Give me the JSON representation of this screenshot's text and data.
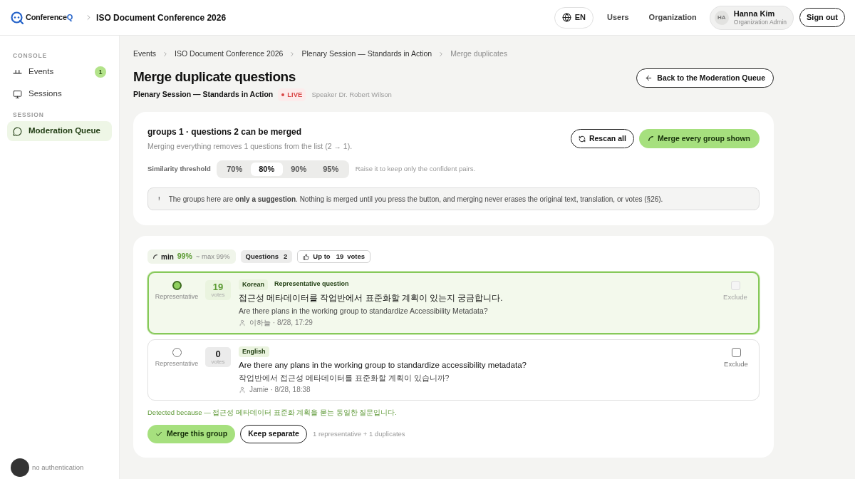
{
  "top_bar": {
    "logo": {
      "name": "Conference",
      "accent": "Q"
    },
    "event": "ISO Document Conference 2026",
    "language": "EN",
    "nav": [
      "Users",
      "Organization"
    ],
    "user": {
      "initials": "HA",
      "name": "Hanna Kim",
      "role": "Organization Admin"
    },
    "sign_out": "Sign out"
  },
  "sidebar": {
    "sections": [
      {
        "label": "CONSOLE",
        "items": [
          {
            "label": "Events",
            "badge": "1",
            "selected": false
          },
          {
            "label": "Sessions",
            "selected": false
          }
        ]
      },
      {
        "label": "SESSION",
        "items": [
          {
            "label": "Moderation Queue",
            "selected": true
          }
        ]
      }
    ],
    "footer": {
      "status": "no authentication"
    }
  },
  "breadcrumbs": [
    {
      "label": "Events",
      "current": false
    },
    {
      "label": "ISO Document Conference 2026",
      "current": false
    },
    {
      "label": "Plenary Session — Standards in Action",
      "current": false
    },
    {
      "label": "Merge duplicates",
      "current": true
    }
  ],
  "header": {
    "title": "Merge duplicate questions",
    "session": "Plenary Session — Standards in Action",
    "live": "LIVE",
    "speaker": "Speaker Dr. Robert Wilson",
    "back_button": "Back to the Moderation Queue"
  },
  "summary": {
    "title": "groups 1 · questions 2 can be merged",
    "subtitle": "Merging everything removes 1 questions from the list (2 → 1).",
    "buttons": [
      {
        "label": "Rescan all",
        "kind": "outline"
      },
      {
        "label": "Merge every group shown",
        "kind": "primary"
      }
    ],
    "threshold": {
      "label": "Similarity threshold",
      "options": [
        {
          "label": "70%",
          "selected": false
        },
        {
          "label": "80%",
          "selected": true
        },
        {
          "label": "90%",
          "selected": false
        },
        {
          "label": "95%",
          "selected": false
        }
      ],
      "hint": "Raise it to keep only the confident pairs."
    },
    "notice": {
      "mark": "!",
      "text": "The groups here are **only a suggestion**. Nothing is merged until you press the button, and merging never erases the original text, translation, or votes (§26)."
    }
  },
  "groups": [
    {
      "similarity": {
        "min_label": "min",
        "min": "99%",
        "max": "~ max 99%"
      },
      "questions_chip": {
        "label": "Questions",
        "count": "2"
      },
      "votes_chip": {
        "prefix": "Up to",
        "count": "19",
        "suffix": "votes"
      },
      "questions": [
        {
          "representative": true,
          "representative_label": "Representative",
          "votes": "19",
          "votes_label": "votes",
          "language": "Korean",
          "tag": "Representative question",
          "text": "접근성 메타데이터를 작업반에서 표준화할 계획이 있는지 궁금합니다.",
          "translation": "Are there plans in the working group to standardize Accessibility Metadata?",
          "meta": "이하늘 · 8/28, 17:29",
          "exclude_label": "Exclude",
          "excluded": false,
          "exclude_disabled": true
        },
        {
          "representative": false,
          "representative_label": "Representative",
          "votes": "0",
          "votes_label": "votes",
          "language": "English",
          "text": "Are there any plans in the working group to standardize accessibility metadata?",
          "translation": "작업반에서 접근성 메타데이터를 표준화할 계획이 있습니까?",
          "meta": "Jamie · 8/28, 18:38",
          "exclude_label": "Exclude",
          "excluded": false,
          "exclude_disabled": false
        }
      ],
      "reason": "Detected because — 접근성 메타데이터 표준화 계획을 묻는 동일한 질문입니다.",
      "actions": {
        "merge": "Merge this group",
        "keep": "Keep separate",
        "summary": "1 representative + 1 duplicates"
      }
    }
  ]
}
